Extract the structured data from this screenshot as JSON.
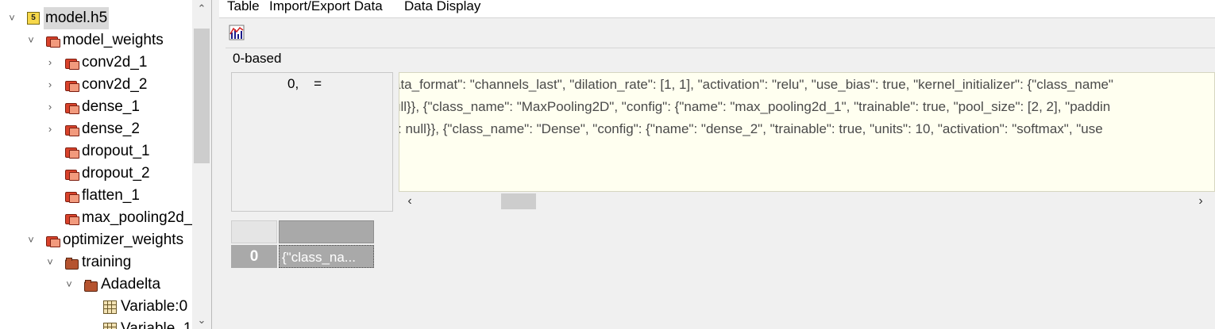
{
  "tree": {
    "items": [
      {
        "label": "model.h5",
        "icon": "h5-file-icon",
        "chevron": "expanded"
      },
      {
        "label": "model_weights",
        "icon": "group-icon",
        "chevron": "expanded"
      },
      {
        "label": "conv2d_1",
        "icon": "group-icon",
        "chevron": "collapsed"
      },
      {
        "label": "conv2d_2",
        "icon": "group-icon",
        "chevron": "collapsed"
      },
      {
        "label": "dense_1",
        "icon": "group-icon",
        "chevron": "collapsed"
      },
      {
        "label": "dense_2",
        "icon": "group-icon",
        "chevron": "collapsed"
      },
      {
        "label": "dropout_1",
        "icon": "group-icon",
        "chevron": "none"
      },
      {
        "label": "dropout_2",
        "icon": "group-icon",
        "chevron": "none"
      },
      {
        "label": "flatten_1",
        "icon": "group-icon",
        "chevron": "none"
      },
      {
        "label": "max_pooling2d_",
        "icon": "group-icon",
        "chevron": "none"
      },
      {
        "label": "optimizer_weights",
        "icon": "group-icon",
        "chevron": "expanded"
      },
      {
        "label": "training",
        "icon": "folder-icon",
        "chevron": "expanded"
      },
      {
        "label": "Adadelta",
        "icon": "folder-icon",
        "chevron": "expanded"
      },
      {
        "label": "Variable:0",
        "icon": "dataset-icon",
        "chevron": "none"
      },
      {
        "label": "Variable_1",
        "icon": "dataset-icon",
        "chevron": "none"
      }
    ]
  },
  "menubar": {
    "table": "Table",
    "import_export": "Import/Export Data",
    "data_display": "Data Display"
  },
  "toolbar": {
    "chart_icon": "line-chart-icon"
  },
  "view": {
    "indexing": "0-based",
    "index_label": "0,    =",
    "content_lines": [
      "ata_format\": \"channels_last\", \"dilation_rate\": [1, 1], \"activation\": \"relu\", \"use_bias\": true, \"kernel_initializer\": {\"class_name\"",
      "ull}}, {\"class_name\": \"MaxPooling2D\", \"config\": {\"name\": \"max_pooling2d_1\", \"trainable\": true, \"pool_size\": [2, 2], \"paddin",
      "\": null}}, {\"class_name\": \"Dense\", \"config\": {\"name\": \"dense_2\", \"trainable\": true, \"units\": 10, \"activation\": \"softmax\", \"use"
    ]
  },
  "table": {
    "row_header": "0",
    "cell_value": "{\"class_na..."
  },
  "colors": {
    "content_bg": "#fffff0",
    "cell_bg": "#a9a9a9"
  }
}
